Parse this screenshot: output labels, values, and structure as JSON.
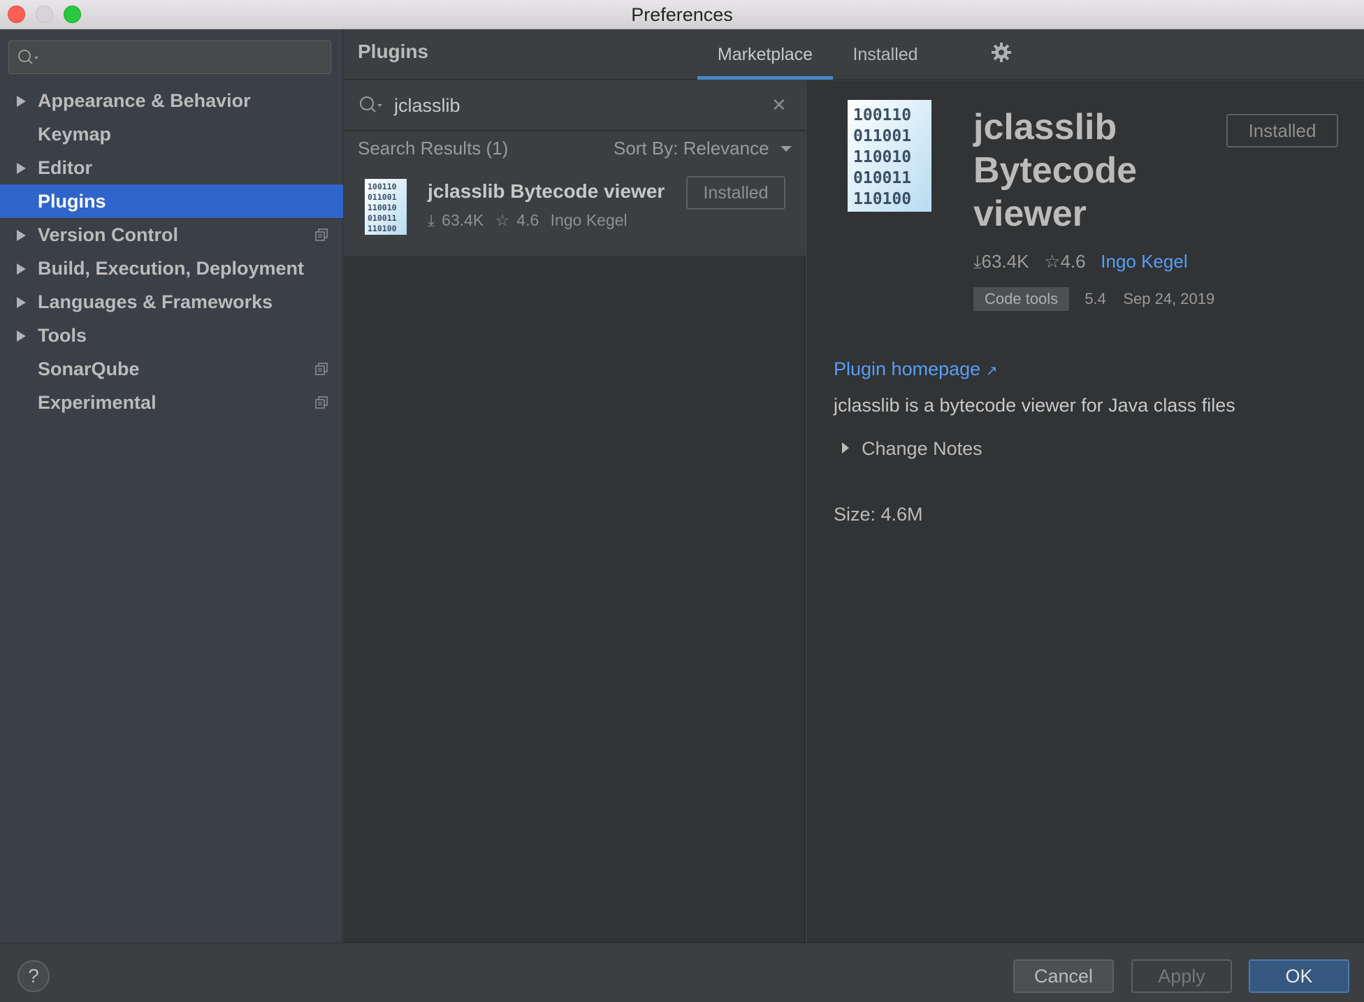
{
  "window": {
    "title": "Preferences"
  },
  "sidebar": {
    "search_placeholder": "",
    "items": [
      {
        "label": "Appearance & Behavior",
        "expandable": true
      },
      {
        "label": "Keymap",
        "expandable": false
      },
      {
        "label": "Editor",
        "expandable": true
      },
      {
        "label": "Plugins",
        "expandable": false,
        "selected": true
      },
      {
        "label": "Version Control",
        "expandable": true,
        "project_icon": true
      },
      {
        "label": "Build, Execution, Deployment",
        "expandable": true
      },
      {
        "label": "Languages & Frameworks",
        "expandable": true
      },
      {
        "label": "Tools",
        "expandable": true
      },
      {
        "label": "SonarQube",
        "expandable": false,
        "project_icon": true
      },
      {
        "label": "Experimental",
        "expandable": false,
        "project_icon": true
      }
    ]
  },
  "header": {
    "title": "Plugins",
    "tabs": [
      {
        "label": "Marketplace",
        "active": true
      },
      {
        "label": "Installed",
        "active": false
      }
    ],
    "settings_icon": "gear-icon"
  },
  "list": {
    "search_value": "jclasslib",
    "results_label": "Search Results (1)",
    "sort_label": "Sort By: Relevance",
    "result": {
      "name": "jclasslib Bytecode viewer",
      "downloads": "63.4K",
      "rating": "4.6",
      "author": "Ingo Kegel",
      "button": "Installed"
    }
  },
  "details": {
    "title": "jclasslib Bytecode viewer",
    "button": "Installed",
    "downloads": "63.4K",
    "rating": "4.6",
    "author": "Ingo Kegel",
    "tag": "Code tools",
    "version": "5.4",
    "date": "Sep 24, 2019",
    "homepage": "Plugin homepage",
    "description": "jclasslib is a bytecode viewer for Java class files",
    "change_notes": "Change Notes",
    "size": "Size: 4.6M",
    "icon_bits": [
      "100110",
      "011001",
      "110010",
      "010011",
      "110100"
    ]
  },
  "footer": {
    "help": "?",
    "cancel": "Cancel",
    "apply": "Apply",
    "ok": "OK"
  },
  "colors": {
    "accent": "#2f65ca",
    "link": "#589df6",
    "tab_underline": "#4a88c7"
  }
}
